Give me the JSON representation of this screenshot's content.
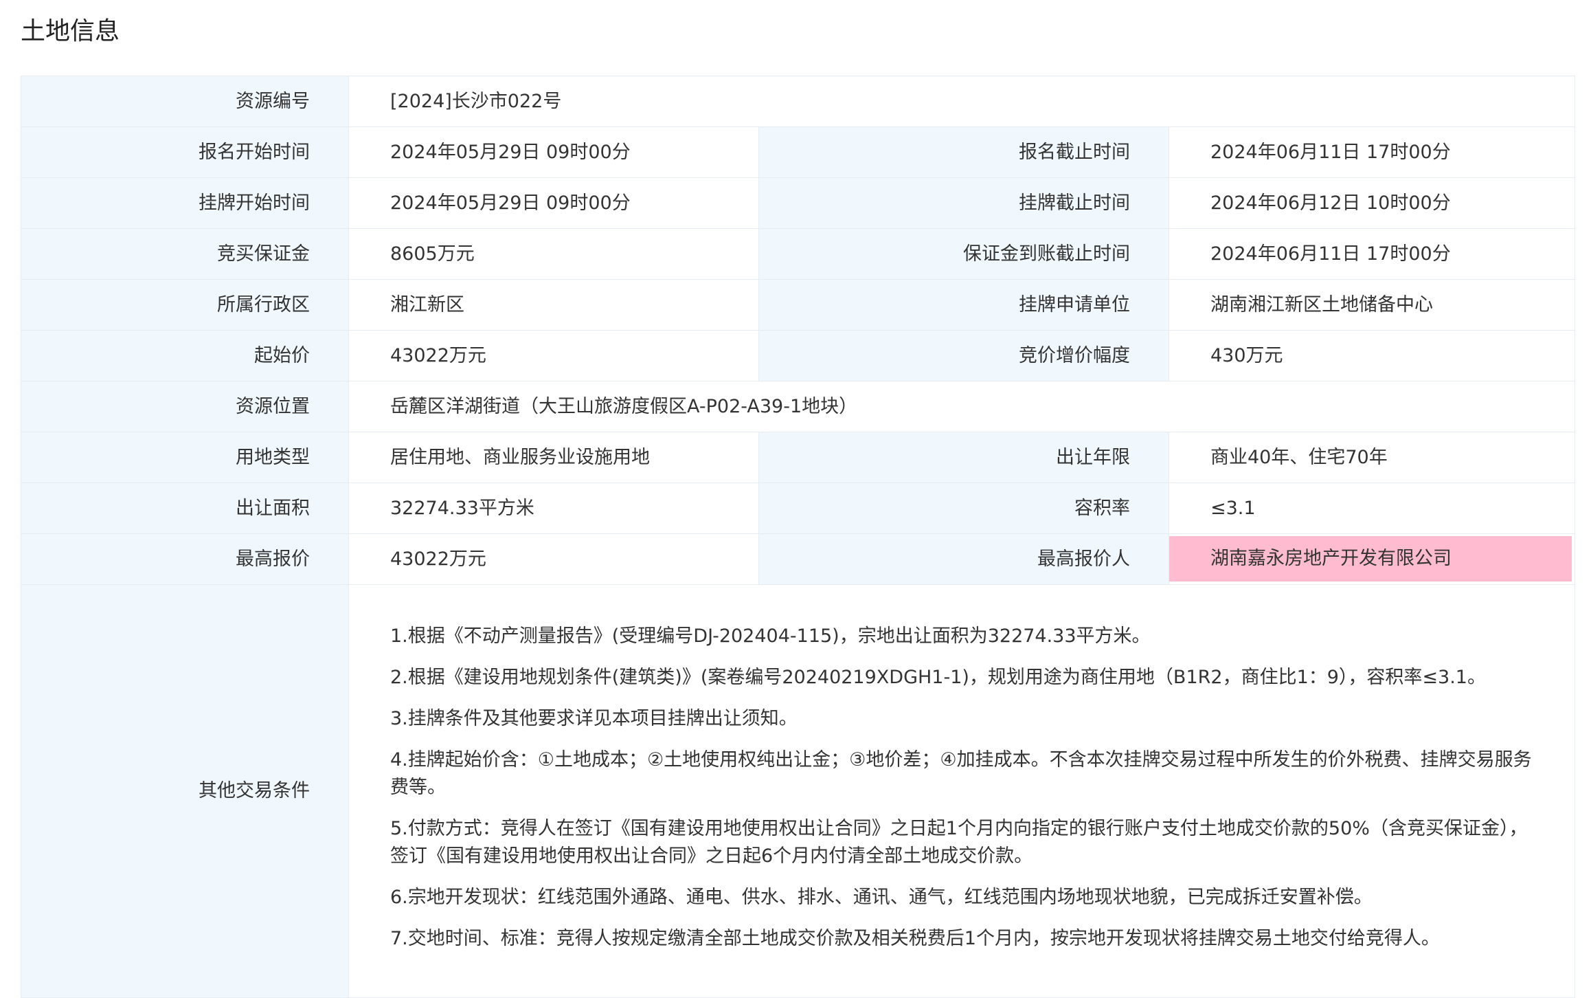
{
  "page_title": "土地信息",
  "rows": {
    "resource_no": {
      "label": "资源编号",
      "value": "[2024]长沙市022号"
    },
    "signup_start": {
      "label": "报名开始时间",
      "value": "2024年05月29日 09时00分"
    },
    "signup_end": {
      "label": "报名截止时间",
      "value": "2024年06月11日 17时00分"
    },
    "listing_start": {
      "label": "挂牌开始时间",
      "value": "2024年05月29日 09时00分"
    },
    "listing_end": {
      "label": "挂牌截止时间",
      "value": "2024年06月12日 10时00分"
    },
    "deposit": {
      "label": "竞买保证金",
      "value": "8605万元"
    },
    "deposit_deadline": {
      "label": "保证金到账截止时间",
      "value": "2024年06月11日 17时00分"
    },
    "district": {
      "label": "所属行政区",
      "value": "湘江新区"
    },
    "applicant": {
      "label": "挂牌申请单位",
      "value": "湖南湘江新区土地储备中心"
    },
    "start_price": {
      "label": "起始价",
      "value": "43022万元"
    },
    "increment": {
      "label": "竞价增价幅度",
      "value": "430万元"
    },
    "location": {
      "label": "资源位置",
      "value": "岳麓区洋湖街道（大王山旅游度假区A-P02-A39-1地块）"
    },
    "land_use": {
      "label": "用地类型",
      "value": "居住用地、商业服务业设施用地"
    },
    "term": {
      "label": "出让年限",
      "value": "商业40年、住宅70年"
    },
    "area": {
      "label": "出让面积",
      "value": "32274.33平方米"
    },
    "far": {
      "label": "容积率",
      "value": "≤3.1"
    },
    "top_bid": {
      "label": "最高报价",
      "value": "43022万元"
    },
    "top_bidder": {
      "label": "最高报价人",
      "value": "湖南嘉永房地产开发有限公司",
      "highlight_color": "#ffbcd0"
    }
  },
  "other_conditions": {
    "label": "其他交易条件",
    "items": [
      "1.根据《不动产测量报告》(受理编号DJ-202404-115)，宗地出让面积为32274.33平方米。",
      "2.根据《建设用地规划条件(建筑类)》(案卷编号20240219XDGH1-1)，规划用途为商住用地（B1R2，商住比1：9），容积率≤3.1。",
      "3.挂牌条件及其他要求详见本项目挂牌出让须知。",
      "4.挂牌起始价含：①土地成本；②土地使用权纯出让金；③地价差；④加挂成本。不含本次挂牌交易过程中所发生的价外税费、挂牌交易服务费等。",
      "5.付款方式：竞得人在签订《国有建设用地使用权出让合同》之日起1个月内向指定的银行账户支付土地成交价款的50%（含竞买保证金），签订《国有建设用地使用权出让合同》之日起6个月内付清全部土地成交价款。",
      "6.宗地开发现状：红线范围外通路、通电、供水、排水、通讯、通气，红线范围内场地现状地貌，已完成拆迁安置补偿。",
      "7.交地时间、标准：竞得人按规定缴清全部土地成交价款及相关税费后1个月内，按宗地开发现状将挂牌交易土地交付给竞得人。"
    ]
  }
}
